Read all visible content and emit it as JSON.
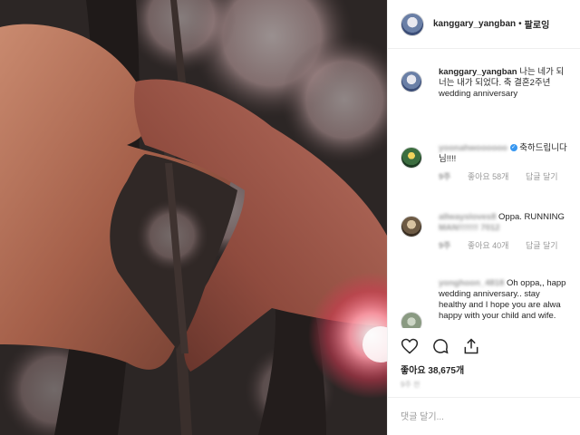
{
  "post": {
    "image_alt": "Hands forming a heart shape in front of cherry blossom trees at night",
    "username": "kanggary_yangban",
    "separator": "•",
    "follow_label": "팔로잉"
  },
  "comments": [
    {
      "user": "kanggary_yangban",
      "text": "나는 네가 되",
      "text2": "너는 내가 되었다. 축 결혼2주년",
      "text3": "wedding anniversary",
      "avatar_icon": "profile-photo-icon"
    },
    {
      "user": "yoonahwoooooo",
      "text": "축하드립니다 ",
      "text2": "님!!!!",
      "likes": "좋아요 58개",
      "reply": "답글 달기",
      "time": "9주",
      "avatar_icon": "profile-photo-icon"
    },
    {
      "user": "allwaysloves8",
      "text": "Oppa. RUNNING",
      "text2": "MAN!!!!!!! 7012",
      "likes": "좋아요 40개",
      "reply": "답글 달기",
      "time": "9주",
      "avatar_icon": "profile-photo-icon"
    },
    {
      "user": "yonghoon_4818",
      "text": "Oh oppa,, happ",
      "text2": "wedding anniversary.. stay",
      "text3": "healthy and I hope you are alwa",
      "text4": "happy with your child and wife.",
      "avatar_icon": "profile-photo-icon"
    }
  ],
  "actions": {
    "like_icon": "heart-outline-icon",
    "comment_icon": "comment-bubble-icon",
    "share_icon": "share-icon"
  },
  "likes_text": "좋아요 38,675개",
  "date_text": "9주 전",
  "add_comment_placeholder": "댓글 달기..."
}
